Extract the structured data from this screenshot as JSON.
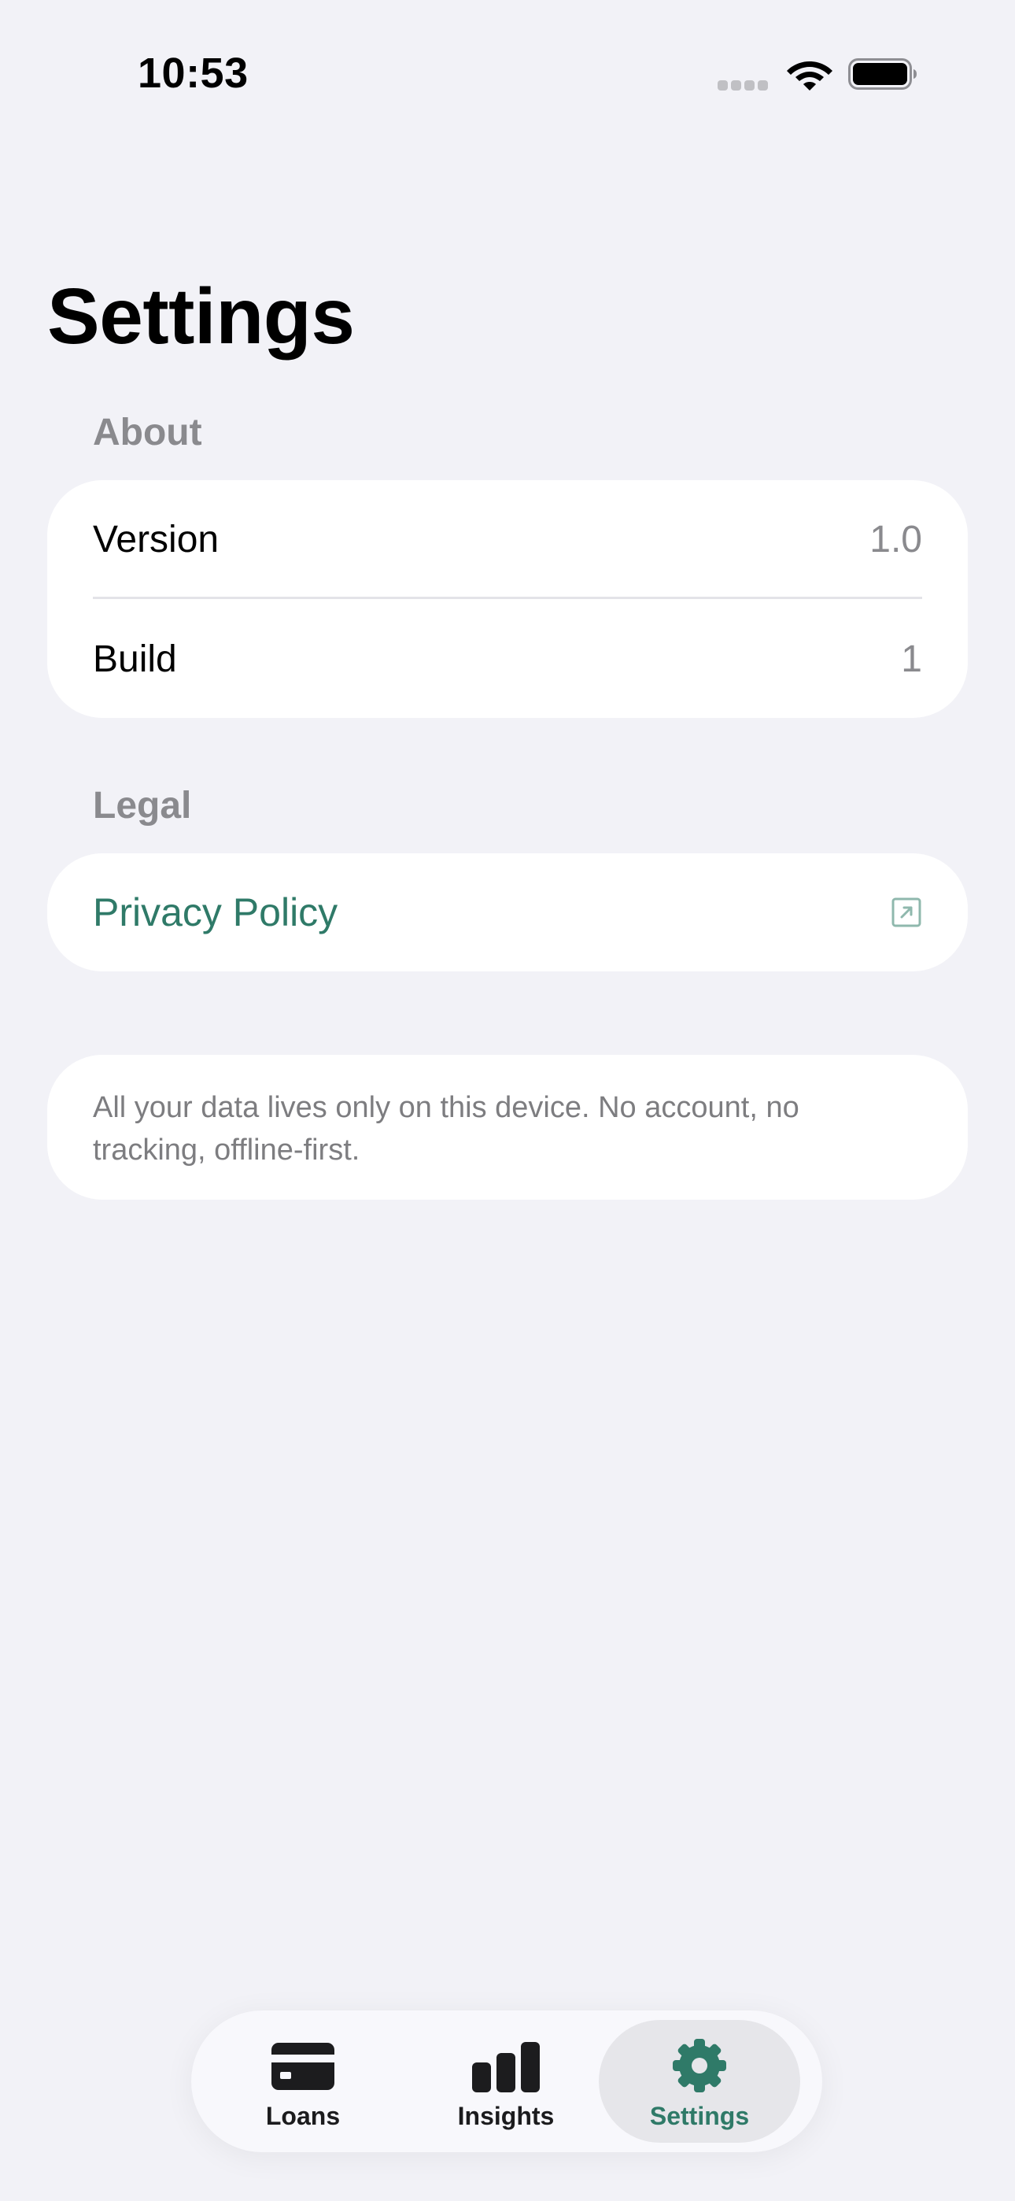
{
  "status_bar": {
    "time": "10:53"
  },
  "page": {
    "title": "Settings"
  },
  "sections": {
    "about": {
      "header": "About",
      "rows": [
        {
          "label": "Version",
          "value": "1.0"
        },
        {
          "label": "Build",
          "value": "1"
        }
      ]
    },
    "legal": {
      "header": "Legal",
      "privacy_label": "Privacy Policy",
      "icon": "external-link-icon"
    },
    "note": "All your data lives only on this device. No account, no tracking, offline-first."
  },
  "tabbar": {
    "tabs": [
      {
        "label": "Loans",
        "icon": "card-icon",
        "active": false
      },
      {
        "label": "Insights",
        "icon": "chart-icon",
        "active": false
      },
      {
        "label": "Settings",
        "icon": "gear-icon",
        "active": true
      }
    ]
  },
  "colors": {
    "accent": "#2f7a68",
    "background": "#f2f2f7",
    "secondary_text": "#8a8a8e"
  }
}
